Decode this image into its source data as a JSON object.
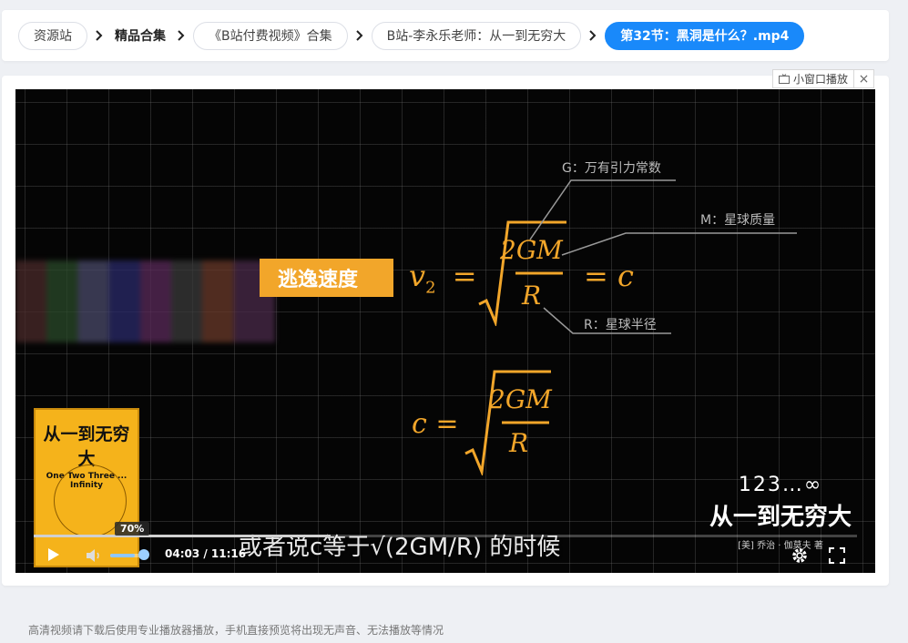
{
  "breadcrumb": {
    "items": [
      {
        "label": "资源站",
        "style": "pill"
      },
      {
        "label": "精品合集",
        "style": "plain"
      },
      {
        "label": "《B站付费视频》合集",
        "style": "pill"
      },
      {
        "label": "B站-李永乐老师：从一到无穷大",
        "style": "pill"
      },
      {
        "label": "第32节：黑洞是什么？.mp4",
        "style": "active"
      }
    ]
  },
  "mini_window": {
    "label": "小窗口播放",
    "close": "×"
  },
  "video": {
    "escape_label": "逃逸速度",
    "formula1": {
      "lhs": "v",
      "sub": "2",
      "eq": "=",
      "num": "2GM",
      "den": "R",
      "rhs": "= c"
    },
    "formula2": {
      "lhs": "c =",
      "num": "2GM",
      "den": "R"
    },
    "annotations": {
      "g": "G：万有引力常数",
      "m": "M：星球质量",
      "r": "R：星球半径"
    },
    "book": {
      "title": "从一到无穷大",
      "subtitle": "One Two Three ... Infinity",
      "spine": "从一到无穷大"
    },
    "logo": {
      "line1": "123…∞",
      "line2": "从一到无穷大",
      "line3": "[美] 乔治 · 伽莫夫 著"
    },
    "subtitle": "或者说c等于√(2GM/R) 的时候"
  },
  "controls": {
    "progress": 0.361,
    "volume": 0.7,
    "volume_tip": "70%",
    "time": "04:03 / 11:16"
  },
  "footer_note": "高清视频请下载后使用专业播放器播放，手机直接预览将出现无声音、无法播放等情况",
  "colors": {
    "accent": "#1989fa",
    "formula": "#f2a62a"
  }
}
